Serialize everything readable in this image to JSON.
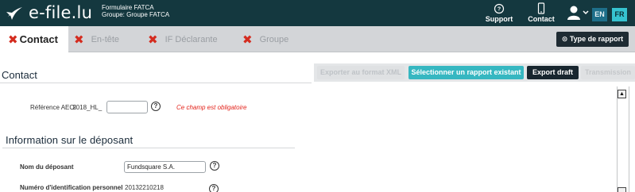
{
  "header": {
    "brand": "e-file.lu",
    "subtitle_line1": "Formulaire FATCA",
    "subtitle_line2": "Groupe: Groupe FATCA",
    "support_label": "Support",
    "contact_label": "Contact",
    "lang_en": "EN",
    "lang_fr": "FR",
    "active_lang": "FR",
    "logo_icon": "star-swoosh-logo",
    "support_icon": "help-circle-icon",
    "contact_icon": "phone-icon",
    "user_icon": "user-icon",
    "colors": {
      "bar": "#14383f",
      "accent": "#36c3d0"
    }
  },
  "tabs": [
    {
      "label": "Contact",
      "status_icon": "error-x-icon",
      "active": true
    },
    {
      "label": "En-tête",
      "status_icon": "error-x-icon",
      "active": false
    },
    {
      "label": "IF Déclarante",
      "status_icon": "error-x-icon",
      "active": false
    },
    {
      "label": "Groupe",
      "status_icon": "error-x-icon",
      "active": false
    }
  ],
  "report_type_button": "⊙ Type de rapport",
  "section": {
    "title": "Contact"
  },
  "actions": {
    "export_xml": "Exporter au format XML",
    "select_report": "Sélectionner un rapport existant",
    "export_draft": "Export draft",
    "transmission": "Transmission"
  },
  "reference": {
    "label": "Référence AEOI",
    "prefix": ".2018_HL_",
    "value": "",
    "help": "?",
    "error": "Ce champ est obligatoire"
  },
  "depositor": {
    "title": "Information sur le déposant",
    "name_label": "Nom du déposant",
    "name_value": "Fundsquare S.A.",
    "id_label": "Numéro d'identification personnel",
    "id_value": "20132210218",
    "help": "?"
  }
}
